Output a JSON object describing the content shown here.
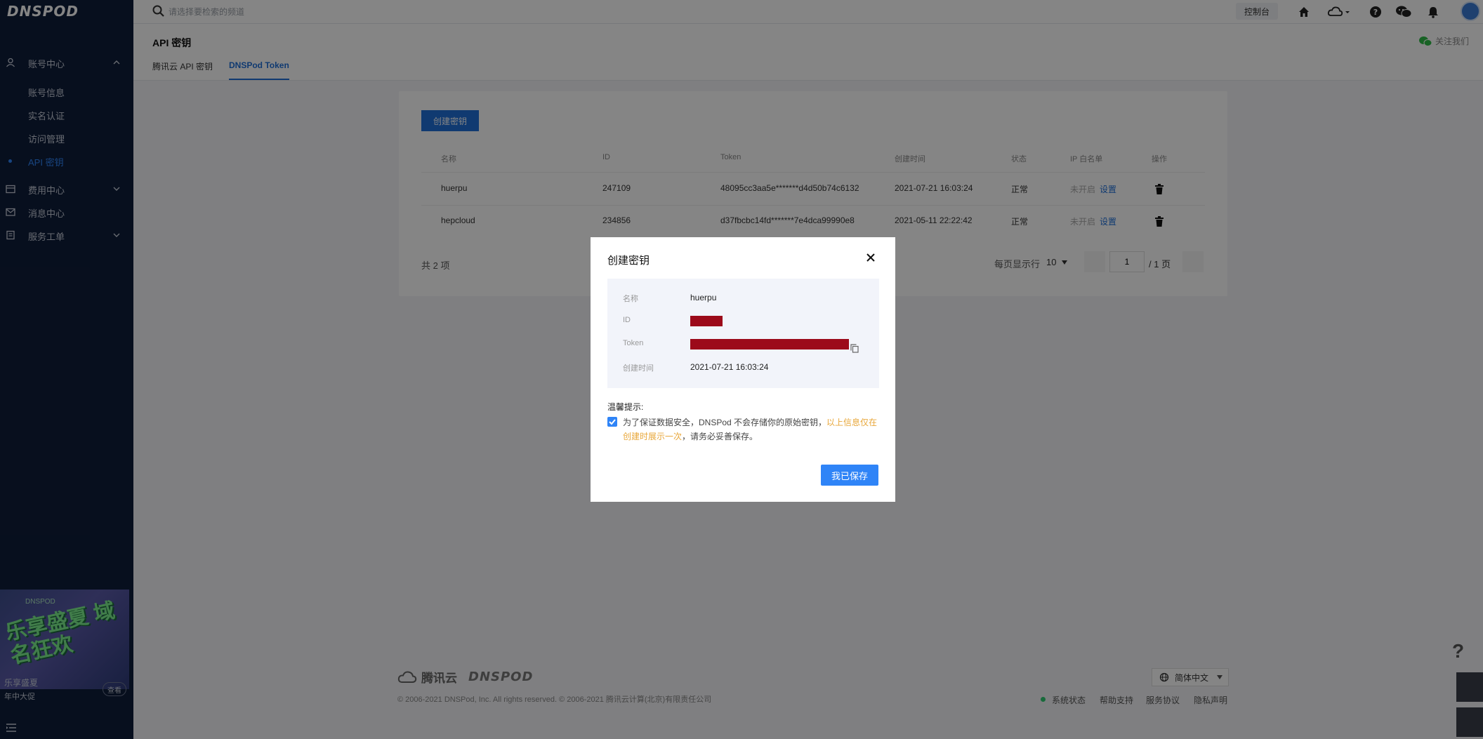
{
  "brand": {
    "logo": "DNSPOD"
  },
  "topbar": {
    "search_placeholder": "请选择要检索的频道",
    "console_label": "控制台",
    "icons": [
      "home-icon",
      "cloud-icon",
      "help-icon",
      "wechat-icon",
      "bell-icon"
    ]
  },
  "sidebar": {
    "groups": [
      {
        "label": "账号中心",
        "icon": "user-icon",
        "expanded": true
      },
      {
        "label": "费用中心",
        "icon": "wallet-icon",
        "expanded": false
      },
      {
        "label": "消息中心",
        "icon": "mail-icon",
        "expanded": false
      },
      {
        "label": "服务工单",
        "icon": "ticket-icon",
        "expanded": false
      }
    ],
    "sub_items": [
      {
        "label": "账号信息"
      },
      {
        "label": "实名认证"
      },
      {
        "label": "访问管理"
      },
      {
        "label": "API 密钥",
        "active": true
      }
    ],
    "promo": {
      "small": "DNSPOD",
      "text": "乐享盛夏 域名狂欢",
      "foot_title": "乐享盛夏",
      "foot_sub": "年中大促",
      "button": "查看"
    }
  },
  "header": {
    "title": "API 密钥",
    "tabs": [
      {
        "label": "腾讯云 API 密钥",
        "active": false
      },
      {
        "label": "DNSPod Token",
        "active": true
      }
    ],
    "follow_label": "关注我们"
  },
  "table": {
    "create_button": "创建密钥",
    "columns": [
      "名称",
      "ID",
      "Token",
      "创建时间",
      "状态",
      "IP 白名单",
      "操作"
    ],
    "rows": [
      {
        "name": "huerpu",
        "id": "247109",
        "token": "48095cc3aa5e*******d4d50b74c6132",
        "created": "2021-07-21 16:03:24",
        "status": "正常",
        "whitelist": "未开启",
        "action": "设置"
      },
      {
        "name": "hepcloud",
        "id": "234856",
        "token": "d37fbcbc14fd*******7e4dca99990e8",
        "created": "2021-05-11 22:22:42",
        "status": "正常",
        "whitelist": "未开启",
        "action": "设置"
      }
    ],
    "total": "共 2 项",
    "page_size_label": "每页显示行",
    "page_size": "10",
    "current_page": "1",
    "total_pages": "/ 1 页"
  },
  "footer": {
    "tencent_cloud": "腾讯云",
    "dnspod": "DNSPOD",
    "copyright": "© 2006-2021 DNSPod, Inc. All rights reserved. © 2006-2021 腾讯云计算(北京)有限责任公司",
    "language": "简体中文",
    "links": [
      "系统状态",
      "帮助支持",
      "服务协议",
      "隐私声明"
    ],
    "help_float": "?"
  },
  "modal": {
    "title": "创建密钥",
    "fields": {
      "name_label": "名称",
      "name_value": "huerpu",
      "id_label": "ID",
      "token_label": "Token",
      "created_label": "创建时间",
      "created_value": "2021-07-21 16:03:24"
    },
    "tip_title": "温馨提示:",
    "tip_text": "为了保证数据安全，DNSPod 不会存储你的原始密钥，",
    "tip_warn": "以上信息仅在创建时展示一次",
    "tip_tail": "，请务必妥善保存。",
    "tip_checked": true,
    "confirm_button": "我已保存"
  },
  "colors": {
    "sidebar_bg": "#0f1d3a",
    "accent": "#2f84f7",
    "redaction": "#9c0a1a",
    "warning": "#e8a73a"
  }
}
